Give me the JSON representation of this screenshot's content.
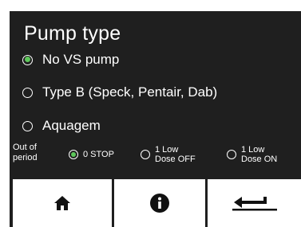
{
  "title": "Pump type",
  "options": [
    {
      "label": "No VS pump",
      "selected": true
    },
    {
      "label": "Type B (Speck, Pentair, Dab)",
      "selected": false
    },
    {
      "label": "Aquagem",
      "selected": false
    }
  ],
  "out_of_period": {
    "label_line1": "Out of",
    "label_line2": "period",
    "choices": [
      {
        "line1": "0 STOP",
        "line2": "",
        "selected": true
      },
      {
        "line1": "1 Low",
        "line2": "Dose OFF",
        "selected": false
      },
      {
        "line1": "1 Low",
        "line2": "Dose ON",
        "selected": false
      }
    ]
  },
  "nav": {
    "home_icon": "home-icon",
    "info_icon": "info-icon",
    "back_icon": "back-arrow-icon"
  },
  "colors": {
    "panel": "#1f1f1f",
    "selected": "#5ec85b",
    "text": "#ffffff",
    "button": "#ffffff"
  }
}
